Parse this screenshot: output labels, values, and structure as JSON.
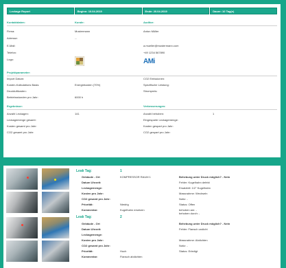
{
  "report": {
    "header": [
      "Leckage Report",
      "Beginn: 10.04.2019",
      "Ende: 20.04.2019",
      "Dauer: 10 Tag(e)"
    ]
  },
  "sections": {
    "contact": "Kontaktdaten:",
    "customer": "Kunde:",
    "auditor": "Auditor:",
    "project": "Projektparameter:",
    "results": "Ergebnisse:",
    "improvements": "Verbesserungen:"
  },
  "contact_labels": [
    "Firma:",
    "Adresse:",
    "E-Mail:",
    "Telefon:",
    "Logo:"
  ],
  "customer_values": [
    "Mustermann",
    "...",
    "",
    "",
    ""
  ],
  "auditor_values": [
    "Anton Müller",
    "",
    "a.mueller@mustermann.com",
    "+49 1234 567890",
    ""
  ],
  "logos": {
    "customer_alt": "customer logo",
    "auditor": "AMi"
  },
  "project_left": {
    "labels": [
      "Import Datum:",
      "Kosten-Kalkulations Basis:",
      "Druckluftkosten:",
      "Betriebsstunden pro Jahr:"
    ],
    "values": [
      "",
      "Energiekosten (70%)",
      "",
      "6000 h"
    ]
  },
  "project_right": {
    "labels": [
      "CO2 Emissionen:",
      "Spezifische Leistung:",
      "Strompreis:"
    ],
    "values": [
      "",
      "",
      ""
    ]
  },
  "results_left": {
    "labels": [
      "Anzahl Leckagen:",
      "Leckagemenge gesamt:",
      "Kosten gesamt pro Jahr:",
      "CO2 gesamt pro Jahr:"
    ],
    "values": [
      "141",
      "",
      "",
      ""
    ]
  },
  "results_right": {
    "labels": [
      "Anzahl behoben:",
      "Eingesparte Leckagemenge:",
      "Kosten gespart pro Jahr:",
      "CO2 gespart pro Jahr:"
    ],
    "values": [
      "1",
      "",
      "",
      ""
    ]
  },
  "leaks": [
    {
      "tag_label": "Leak Tag:",
      "tag_value": "1",
      "labels": [
        "Gebäude - Ort",
        "Datum Uhrzeit:",
        "Leckagemenge:",
        "Kosten pro Jahr:",
        "CO2 gesamt pro Jahr:",
        "Priorität:",
        "Kommentar:"
      ],
      "values": [
        "KOMPRESSOR RAUM 1",
        "",
        "",
        "",
        "",
        "Niedrig",
        "Kugelhahn ersetzen"
      ],
      "right": [
        "Behebung unter Druck möglich? - Nein",
        "Fehler: Kugelhahn defekt",
        "Ersatzteil: 1/2\" Kugelhahn",
        "Massnahme: Wechseln",
        "Notiz: -",
        "Status: Offen",
        "behoben am: -",
        "behoben durch: -"
      ]
    },
    {
      "tag_label": "Leak Tag:",
      "tag_value": "2",
      "labels": [
        "Gebäude - Ort",
        "Datum Uhrzeit:",
        "Leckagemenge:",
        "Kosten pro Jahr:",
        "CO2 gesamt pro Jahr:",
        "Priorität:",
        "Kommentar:"
      ],
      "values": [
        "",
        "",
        "",
        "",
        "",
        "Hoch",
        "Flansch abdichten"
      ],
      "right": [
        "Behebung unter Druck möglich? - Nein",
        "Fehler: Flansch undicht",
        "",
        "Massnahme: Abdichten",
        "Notiz: -",
        "Status: Erledigt",
        "",
        ""
      ]
    }
  ]
}
